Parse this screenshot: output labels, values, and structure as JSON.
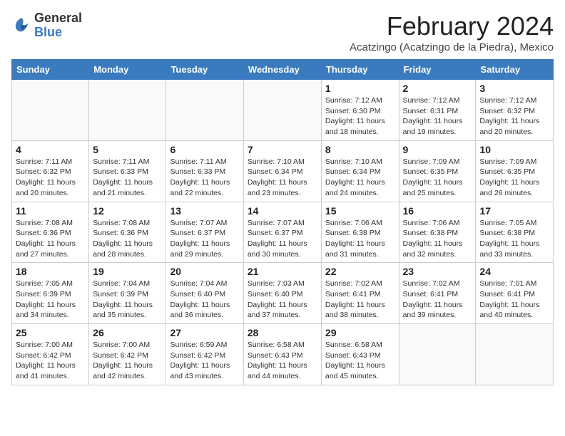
{
  "header": {
    "logo_general": "General",
    "logo_blue": "Blue",
    "main_title": "February 2024",
    "subtitle": "Acatzingo (Acatzingo de la Piedra), Mexico"
  },
  "columns": [
    "Sunday",
    "Monday",
    "Tuesday",
    "Wednesday",
    "Thursday",
    "Friday",
    "Saturday"
  ],
  "weeks": [
    [
      {
        "day": "",
        "info": ""
      },
      {
        "day": "",
        "info": ""
      },
      {
        "day": "",
        "info": ""
      },
      {
        "day": "",
        "info": ""
      },
      {
        "day": "1",
        "info": "Sunrise: 7:12 AM\nSunset: 6:30 PM\nDaylight: 11 hours and 18 minutes."
      },
      {
        "day": "2",
        "info": "Sunrise: 7:12 AM\nSunset: 6:31 PM\nDaylight: 11 hours and 19 minutes."
      },
      {
        "day": "3",
        "info": "Sunrise: 7:12 AM\nSunset: 6:32 PM\nDaylight: 11 hours and 20 minutes."
      }
    ],
    [
      {
        "day": "4",
        "info": "Sunrise: 7:11 AM\nSunset: 6:32 PM\nDaylight: 11 hours and 20 minutes."
      },
      {
        "day": "5",
        "info": "Sunrise: 7:11 AM\nSunset: 6:33 PM\nDaylight: 11 hours and 21 minutes."
      },
      {
        "day": "6",
        "info": "Sunrise: 7:11 AM\nSunset: 6:33 PM\nDaylight: 11 hours and 22 minutes."
      },
      {
        "day": "7",
        "info": "Sunrise: 7:10 AM\nSunset: 6:34 PM\nDaylight: 11 hours and 23 minutes."
      },
      {
        "day": "8",
        "info": "Sunrise: 7:10 AM\nSunset: 6:34 PM\nDaylight: 11 hours and 24 minutes."
      },
      {
        "day": "9",
        "info": "Sunrise: 7:09 AM\nSunset: 6:35 PM\nDaylight: 11 hours and 25 minutes."
      },
      {
        "day": "10",
        "info": "Sunrise: 7:09 AM\nSunset: 6:35 PM\nDaylight: 11 hours and 26 minutes."
      }
    ],
    [
      {
        "day": "11",
        "info": "Sunrise: 7:08 AM\nSunset: 6:36 PM\nDaylight: 11 hours and 27 minutes."
      },
      {
        "day": "12",
        "info": "Sunrise: 7:08 AM\nSunset: 6:36 PM\nDaylight: 11 hours and 28 minutes."
      },
      {
        "day": "13",
        "info": "Sunrise: 7:07 AM\nSunset: 6:37 PM\nDaylight: 11 hours and 29 minutes."
      },
      {
        "day": "14",
        "info": "Sunrise: 7:07 AM\nSunset: 6:37 PM\nDaylight: 11 hours and 30 minutes."
      },
      {
        "day": "15",
        "info": "Sunrise: 7:06 AM\nSunset: 6:38 PM\nDaylight: 11 hours and 31 minutes."
      },
      {
        "day": "16",
        "info": "Sunrise: 7:06 AM\nSunset: 6:38 PM\nDaylight: 11 hours and 32 minutes."
      },
      {
        "day": "17",
        "info": "Sunrise: 7:05 AM\nSunset: 6:38 PM\nDaylight: 11 hours and 33 minutes."
      }
    ],
    [
      {
        "day": "18",
        "info": "Sunrise: 7:05 AM\nSunset: 6:39 PM\nDaylight: 11 hours and 34 minutes."
      },
      {
        "day": "19",
        "info": "Sunrise: 7:04 AM\nSunset: 6:39 PM\nDaylight: 11 hours and 35 minutes."
      },
      {
        "day": "20",
        "info": "Sunrise: 7:04 AM\nSunset: 6:40 PM\nDaylight: 11 hours and 36 minutes."
      },
      {
        "day": "21",
        "info": "Sunrise: 7:03 AM\nSunset: 6:40 PM\nDaylight: 11 hours and 37 minutes."
      },
      {
        "day": "22",
        "info": "Sunrise: 7:02 AM\nSunset: 6:41 PM\nDaylight: 11 hours and 38 minutes."
      },
      {
        "day": "23",
        "info": "Sunrise: 7:02 AM\nSunset: 6:41 PM\nDaylight: 11 hours and 39 minutes."
      },
      {
        "day": "24",
        "info": "Sunrise: 7:01 AM\nSunset: 6:41 PM\nDaylight: 11 hours and 40 minutes."
      }
    ],
    [
      {
        "day": "25",
        "info": "Sunrise: 7:00 AM\nSunset: 6:42 PM\nDaylight: 11 hours and 41 minutes."
      },
      {
        "day": "26",
        "info": "Sunrise: 7:00 AM\nSunset: 6:42 PM\nDaylight: 11 hours and 42 minutes."
      },
      {
        "day": "27",
        "info": "Sunrise: 6:59 AM\nSunset: 6:42 PM\nDaylight: 11 hours and 43 minutes."
      },
      {
        "day": "28",
        "info": "Sunrise: 6:58 AM\nSunset: 6:43 PM\nDaylight: 11 hours and 44 minutes."
      },
      {
        "day": "29",
        "info": "Sunrise: 6:58 AM\nSunset: 6:43 PM\nDaylight: 11 hours and 45 minutes."
      },
      {
        "day": "",
        "info": ""
      },
      {
        "day": "",
        "info": ""
      }
    ]
  ]
}
